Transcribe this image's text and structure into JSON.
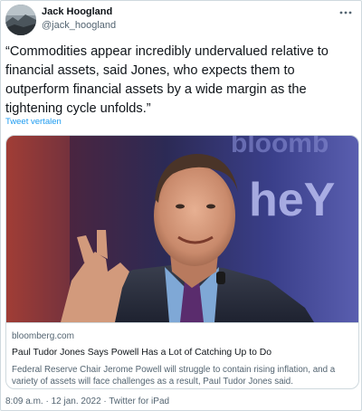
{
  "author": {
    "name": "Jack Hoogland",
    "handle": "@jack_hoogland"
  },
  "tweet": {
    "text": "“Commodities appear incredibly undervalued relative to financial assets, said Jones, who expects them to outperform financial assets by a wide margin as the tightening cycle unfolds.”",
    "translate_label": "Tweet vertalen"
  },
  "card": {
    "domain": "bloomberg.com",
    "title": "Paul Tudor Jones Says Powell Has a Lot of Catching Up to Do",
    "description": "Federal Reserve Chair Jerome Powell will struggle to contain rising inflation, and a variety of assets will face challenges as a result, Paul Tudor Jones said.",
    "image_backdrop_text": "bloomb",
    "image_backdrop_text2": "heY"
  },
  "meta": {
    "time": "8:09 a.m.",
    "separator1": " · ",
    "date": "12 jan. 2022",
    "separator2": " · ",
    "client": "Twitter for iPad"
  },
  "icons": {
    "more": "more-horizontal-icon"
  },
  "colors": {
    "link": "#1d9bf0",
    "secondary_text": "#536471",
    "border": "#cfd9de"
  }
}
